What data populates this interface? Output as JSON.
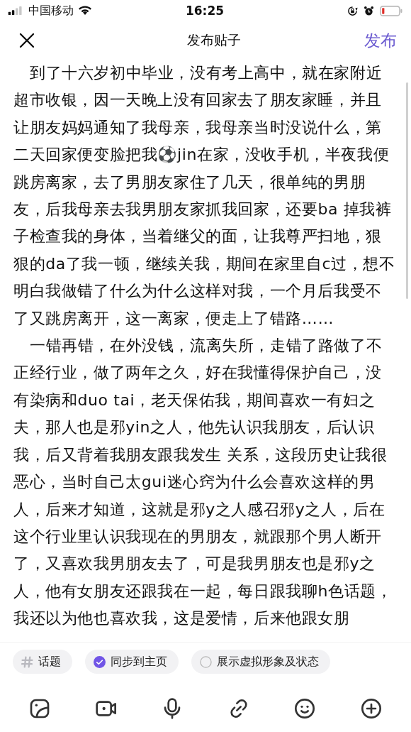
{
  "status_bar": {
    "carrier": "中国移动",
    "time": "16:25"
  },
  "header": {
    "title": "发布贴子",
    "publish": "发布"
  },
  "post": {
    "paragraphs": [
      "到了十六岁初中毕业，没有考上高中，就在家附近超市收银，因一天晚上没有回家去了朋友家睡，并且让朋友妈妈通知了我母亲，我母亲当时没说什么，第二天回家便变脸把我⚽jin在家，没收手机，半夜我便跳房离家，去了男朋友家住了几天，很单纯的男朋友，后我母亲去我男朋友家抓我回家，还要ba 掉我裤子检查我的身体，当着继父的面，让我尊严扫地，狠狠的da了我一顿，继续关我，期间在家里自c过，想不明白我做错了什么为什么这样对我，一个月后我受不了又跳房离开，这一离家，便走上了错路……",
      "一错再错，在外没钱，流离失所，走错了路做了不正经行业，做了两年之久，好在我懂得保护自己，没有染病和duo tai，老天保佑我，期间喜欢一有妇之夫，那人也是邪yin之人，他先认识我朋友，后认识我，后又背着我朋友跟我发生 关系，这段历史让我很恶心，当时自己太gui迷心窍为什么会喜欢这样的男人，后来才知道，这就是邪y之人感召邪y之人，后在这个行业里认识我现在的男朋友，就跟那个男人断开了，又喜欢我男朋友去了，可是我男朋友也是邪y之人，他有女朋友还跟我在一起，每日跟我聊h色话题，我还以为他也喜欢我，这是爱情，后来他跟女朋"
    ]
  },
  "options": [
    {
      "kind": "topic",
      "label": "话题"
    },
    {
      "kind": "toggle",
      "label": "同步到主页",
      "checked": true
    },
    {
      "kind": "toggle",
      "label": "展示虚拟形象及状态",
      "checked": false
    }
  ],
  "toolbar": [
    {
      "kind": "image"
    },
    {
      "kind": "video"
    },
    {
      "kind": "mic"
    },
    {
      "kind": "link"
    },
    {
      "kind": "emoji"
    },
    {
      "kind": "add"
    }
  ]
}
